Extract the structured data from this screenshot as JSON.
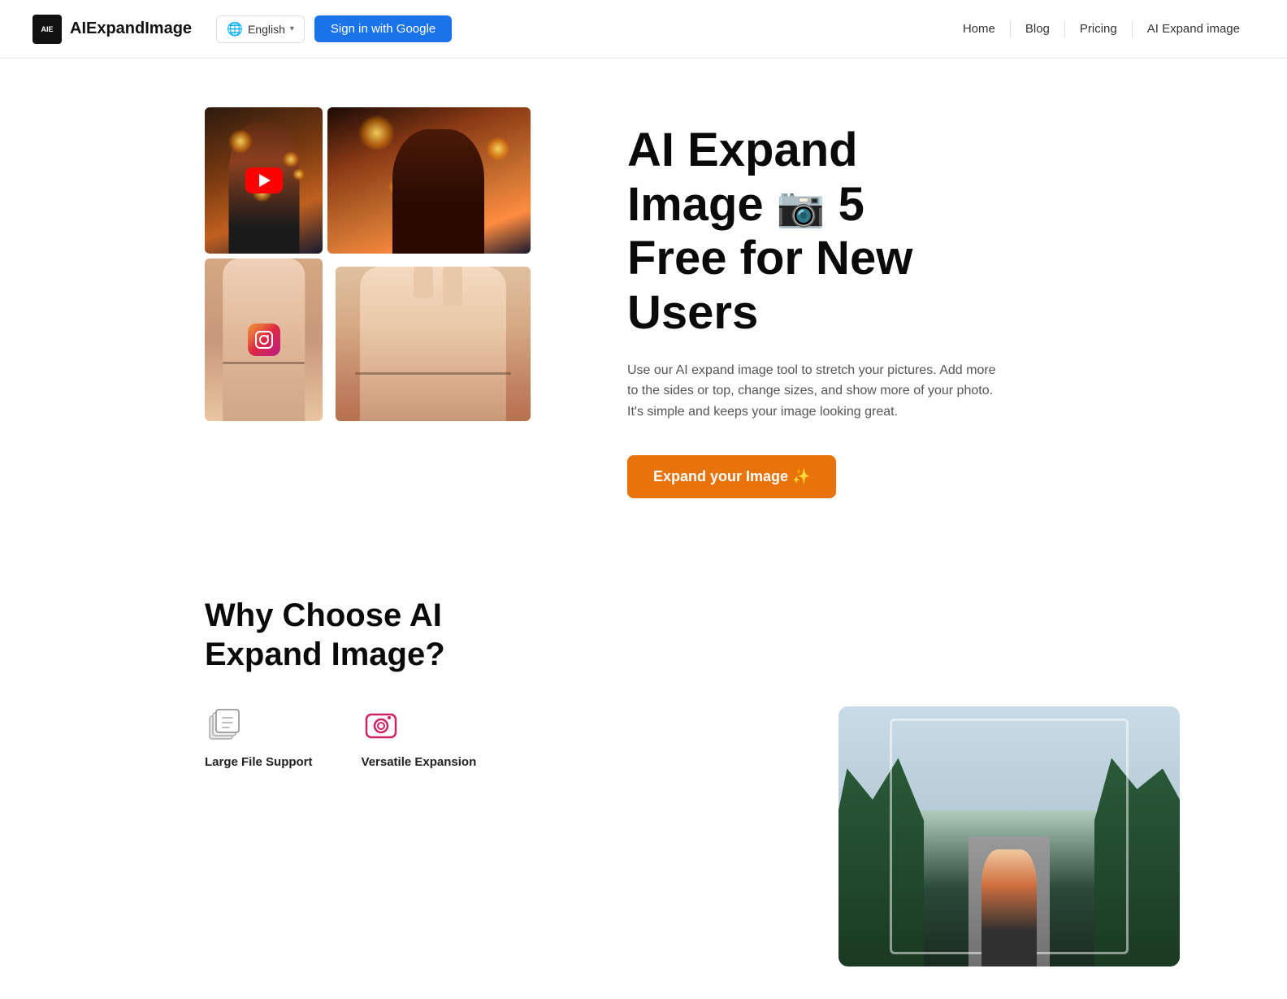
{
  "brand": {
    "logo_text": "AIE",
    "name": "AIExpandImage"
  },
  "navbar": {
    "lang_label": "English",
    "lang_chevron": "▾",
    "signin_label": "Sign in with Google",
    "links": [
      {
        "id": "home",
        "label": "Home"
      },
      {
        "id": "blog",
        "label": "Blog"
      },
      {
        "id": "pricing",
        "label": "Pricing"
      },
      {
        "id": "ai-expand",
        "label": "AI Expand image"
      }
    ]
  },
  "hero": {
    "title_line1": "AI Expand",
    "title_line2": "Image",
    "title_emoji_camera": "📷",
    "title_number": "5",
    "title_line3": "Free for New",
    "title_line4": "Users",
    "description": "Use our AI expand image tool to stretch your pictures. Add more to the sides or top, change sizes, and show more of your photo. It's simple and keeps your image looking great.",
    "cta_label": "Expand your Image ✨"
  },
  "why": {
    "title_line1": "Why Choose AI",
    "title_line2": "Expand Image?",
    "features": [
      {
        "id": "large-file",
        "icon": "🗂️",
        "label": "Large File Support"
      },
      {
        "id": "versatile",
        "icon": "📸",
        "label": "Versatile Expansion"
      }
    ]
  },
  "colors": {
    "accent_blue": "#1a73e8",
    "accent_orange": "#e8730a",
    "instagram_gradient_start": "#f09433",
    "instagram_gradient_end": "#bc1888",
    "youtube_red": "#ff0000",
    "text_dark": "#0a0a0a",
    "text_muted": "#555555"
  }
}
